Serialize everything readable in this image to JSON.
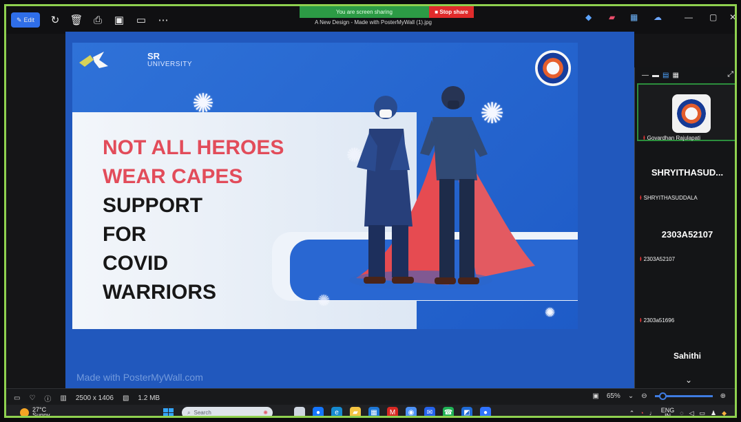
{
  "window": {
    "edit_label": "Edit",
    "share_status": "You are screen sharing",
    "stop_share_label": "Stop share",
    "file_name": "A New Design - Made with PosterMyWall (1).jpg"
  },
  "toolbar": {
    "icons": [
      "rotate-icon",
      "delete-icon",
      "print-icon",
      "gallery-icon",
      "slideshow-icon",
      "more-icon"
    ]
  },
  "poster": {
    "brand_line1": "SR",
    "brand_line2": "UNIVERSITY",
    "headline": {
      "red_lines": [
        "NOT ALL HEROES",
        "WEAR CAPES"
      ],
      "dark_lines": [
        "SUPPORT",
        "FOR",
        "COVID",
        "WARRIORS"
      ]
    },
    "watermark": "Made with PosterMyWall.com",
    "colors": {
      "accent_red": "#e24c5a",
      "poster_blue": "#2f72d8",
      "cape_red": "#e5484f"
    }
  },
  "meeting_sidebar": {
    "participants": [
      {
        "label": "Govardhan Rajulapati",
        "display": ""
      },
      {
        "label": "SHRYITHASUDDALA",
        "display": "SHRYITHASUD..."
      },
      {
        "label": "2303A52107",
        "display": "2303A52107"
      },
      {
        "label": "2303a51696",
        "display": ""
      },
      {
        "label": "",
        "display": "Sahithi"
      }
    ]
  },
  "status_bar": {
    "dimensions": "2500 x 1406",
    "file_size": "1.2 MB",
    "zoom": "65%"
  },
  "taskbar": {
    "temperature": "27°C",
    "weather": "Sunny",
    "search_placeholder": "Search",
    "language": "ENG",
    "region": "IN"
  }
}
